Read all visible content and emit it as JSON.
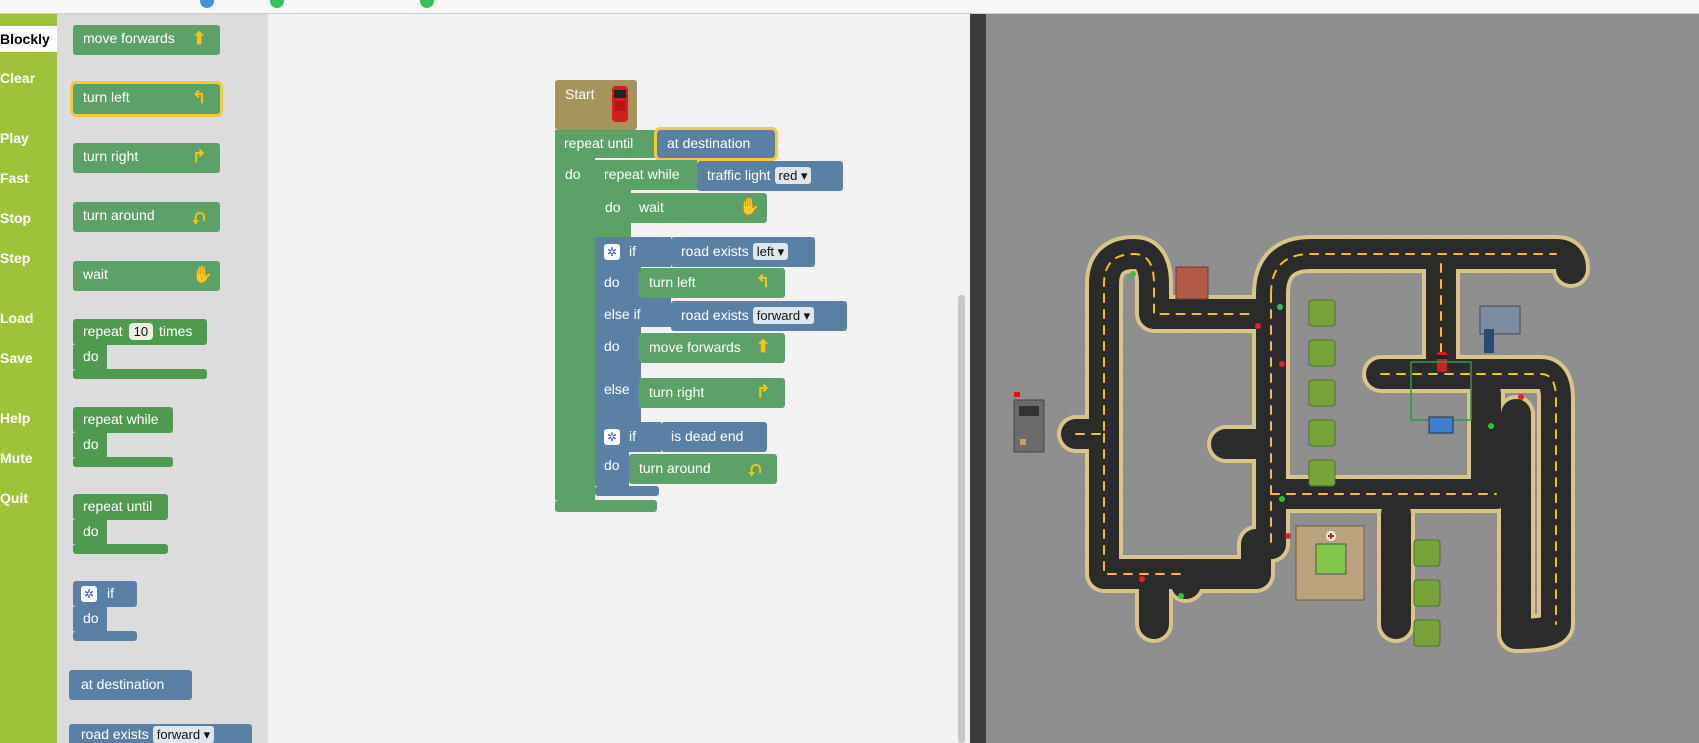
{
  "sidebar": {
    "items": [
      "Blockly",
      "Clear",
      "Play",
      "Fast",
      "Stop",
      "Step",
      "Load",
      "Save",
      "Help",
      "Mute",
      "Quit"
    ],
    "active": "Blockly"
  },
  "toolbox": {
    "move_forwards": "move forwards",
    "turn_left": "turn left",
    "turn_right": "turn right",
    "turn_around": "turn around",
    "wait": "wait",
    "repeat_prefix": "repeat",
    "repeat_count": "10",
    "repeat_suffix": "times",
    "do": "do",
    "repeat_while": "repeat while",
    "repeat_until": "repeat until",
    "if": "if",
    "at_destination": "at destination",
    "road_exists": "road exists",
    "road_exists_option": "forward"
  },
  "program": {
    "start": "Start",
    "repeat_until": "repeat until",
    "at_destination": "at destination",
    "do": "do",
    "repeat_while": "repeat while",
    "traffic_light": "traffic light",
    "traffic_light_option": "red",
    "wait": "wait",
    "if": "if",
    "road_exists": "road exists",
    "road_exists_left": "left",
    "turn_left": "turn left",
    "else_if": "else if",
    "road_exists_forward": "forward",
    "move_forwards": "move forwards",
    "else": "else",
    "turn_right": "turn right",
    "is_dead_end": "is dead end",
    "turn_around": "turn around"
  },
  "icons": {
    "move_forwards": "arrow-up-icon",
    "turn_left": "turn-left-icon",
    "turn_right": "turn-right-icon",
    "turn_around": "u-turn-icon",
    "wait": "hand-icon",
    "start": "van-icon",
    "gear": "gear-icon"
  },
  "colors": {
    "sidebar": "#9ec33b",
    "action_block": "#5ba168",
    "control_block": "#4e9a4f",
    "logic_block": "#5b80a5",
    "start_block": "#a5945b",
    "selection": "#f5c842",
    "map_bg": "#8e8e8e",
    "road": "#2b2b2b",
    "road_edge": "#d9c48a",
    "lane_mark": "#f3c21b"
  }
}
